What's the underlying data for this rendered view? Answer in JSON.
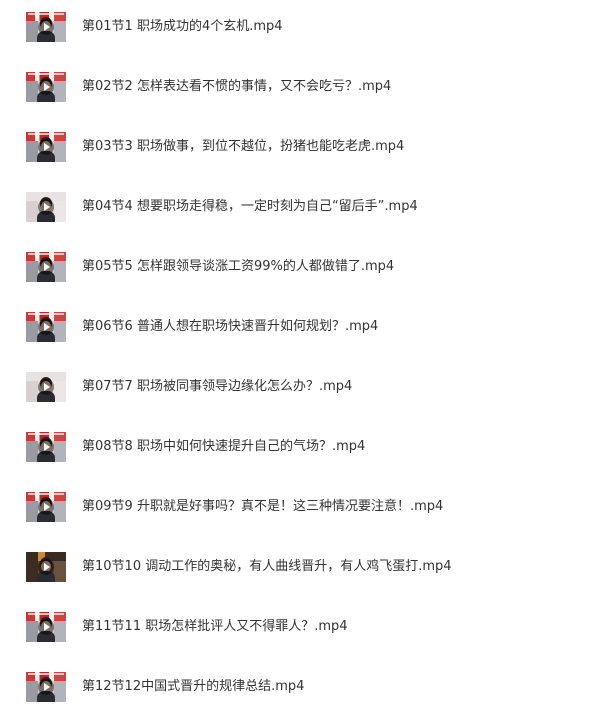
{
  "files": [
    {
      "name": "第01节1 职场成功的4个玄机.mp4",
      "thumb_icon": "video-thumbnail"
    },
    {
      "name": "第02节2 怎样表达看不惯的事情，又不会吃亏？.mp4",
      "thumb_icon": "video-thumbnail"
    },
    {
      "name": "第03节3 职场做事，到位不越位，扮猪也能吃老虎.mp4",
      "thumb_icon": "video-thumbnail"
    },
    {
      "name": "第04节4 想要职场走得稳，一定时刻为自己“留后手”.mp4",
      "thumb_icon": "video-thumbnail"
    },
    {
      "name": "第05节5 怎样跟领导谈涨工资99%的人都做错了.mp4",
      "thumb_icon": "video-thumbnail"
    },
    {
      "name": "第06节6 普通人想在职场快速晋升如何规划？.mp4",
      "thumb_icon": "video-thumbnail"
    },
    {
      "name": "第07节7 职场被同事领导边缘化怎么办？.mp4",
      "thumb_icon": "video-thumbnail"
    },
    {
      "name": "第08节8 职场中如何快速提升自己的气场？.mp4",
      "thumb_icon": "video-thumbnail"
    },
    {
      "name": "第09节9 升职就是好事吗？真不是！这三种情况要注意！.mp4",
      "thumb_icon": "video-thumbnail"
    },
    {
      "name": "第10节10 调动工作的奥秘，有人曲线晋升，有人鸡飞蛋打.mp4",
      "thumb_icon": "video-thumbnail"
    },
    {
      "name": "第11节11 职场怎样批评人又不得罪人？.mp4",
      "thumb_icon": "video-thumbnail"
    },
    {
      "name": "第12节12中国式晋升的规律总结.mp4",
      "thumb_icon": "video-thumbnail"
    }
  ],
  "colors": {
    "text": "#333333",
    "background": "#ffffff"
  }
}
